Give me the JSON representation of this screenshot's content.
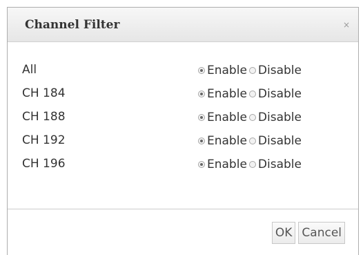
{
  "dialog": {
    "title": "Channel Filter",
    "close_glyph": "×",
    "close_icon": "close-icon"
  },
  "rows": [
    {
      "label": "All",
      "enable_label": "Enable",
      "disable_label": "Disable",
      "selected": "Enable"
    },
    {
      "label": "CH 184",
      "enable_label": "Enable",
      "disable_label": "Disable",
      "selected": "Enable"
    },
    {
      "label": "CH 188",
      "enable_label": "Enable",
      "disable_label": "Disable",
      "selected": "Enable"
    },
    {
      "label": "CH 192",
      "enable_label": "Enable",
      "disable_label": "Disable",
      "selected": "Enable"
    },
    {
      "label": "CH 196",
      "enable_label": "Enable",
      "disable_label": "Disable",
      "selected": "Enable"
    }
  ],
  "footer": {
    "ok_label": "OK",
    "cancel_label": "Cancel"
  }
}
